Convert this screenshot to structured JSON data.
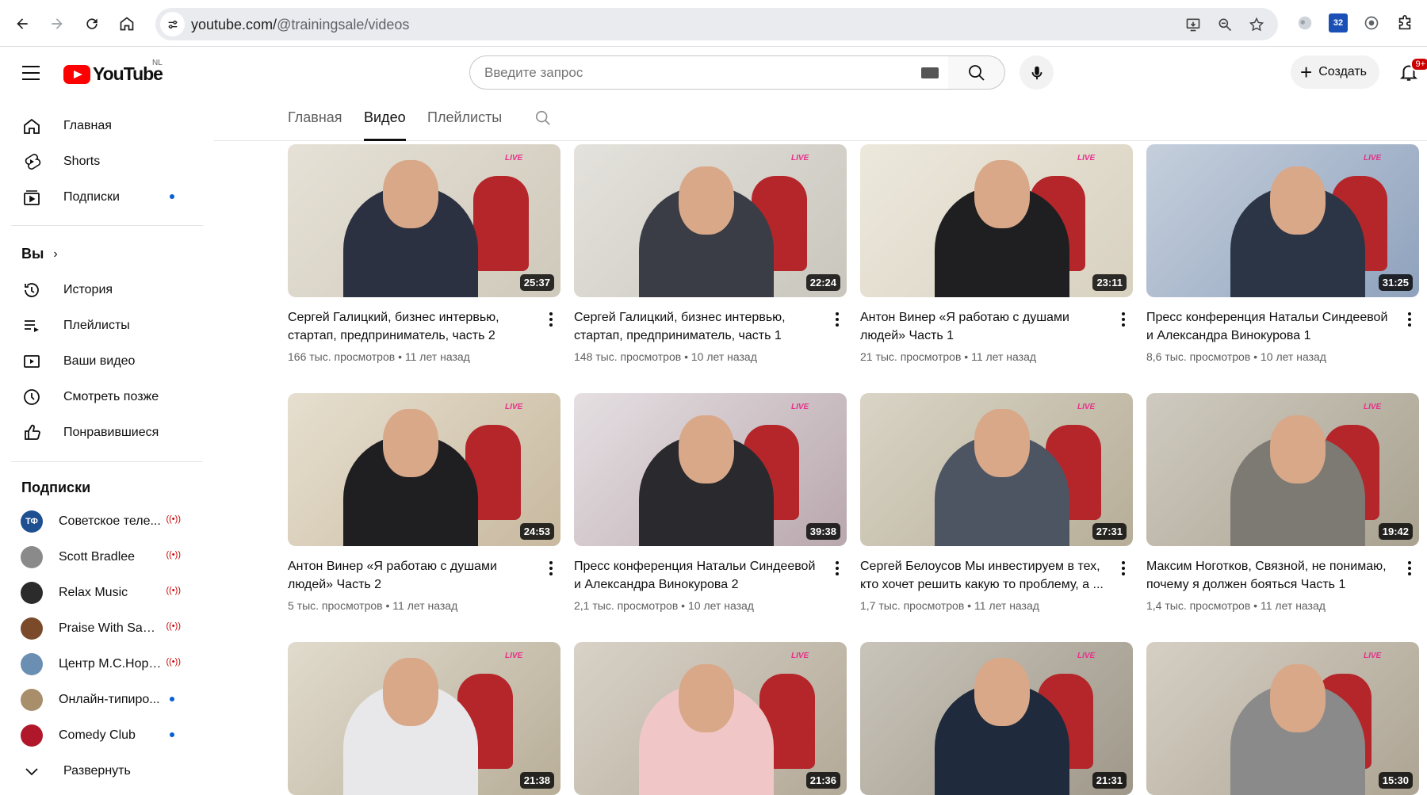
{
  "browser": {
    "url_host": "youtube.com/",
    "url_path": "@trainingsale/videos",
    "ext_badge": "32"
  },
  "masthead": {
    "logo_text": "YouTube",
    "country_code": "NL",
    "search_placeholder": "Введите запрос",
    "create_label": "Создать",
    "notifications_count": "9+"
  },
  "sidebar": {
    "main": [
      {
        "label": "Главная",
        "icon": "home-icon"
      },
      {
        "label": "Shorts",
        "icon": "shorts-icon"
      },
      {
        "label": "Подписки",
        "icon": "subscriptions-icon"
      }
    ],
    "you_heading": "Вы",
    "you": [
      {
        "label": "История",
        "icon": "history-icon"
      },
      {
        "label": "Плейлисты",
        "icon": "playlists-icon"
      },
      {
        "label": "Ваши видео",
        "icon": "your-videos-icon"
      },
      {
        "label": "Смотреть позже",
        "icon": "watch-later-icon"
      },
      {
        "label": "Понравившиеся",
        "icon": "liked-icon"
      }
    ],
    "subs_heading": "Подписки",
    "subscriptions": [
      {
        "label": "Советское теле...",
        "status": "live",
        "color": "#1d4f91"
      },
      {
        "label": "Scott Bradlee",
        "status": "live",
        "color": "#8a8a8a"
      },
      {
        "label": "Relax Music",
        "status": "live",
        "color": "#2b2b2b"
      },
      {
        "label": "Praise With Sang...",
        "status": "live",
        "color": "#7a4a2a"
      },
      {
        "label": "Центр М.С.Норб...",
        "status": "live",
        "color": "#6b8fb3"
      },
      {
        "label": "Онлайн-типиро...",
        "status": "new",
        "color": "#a88e6a"
      },
      {
        "label": "Comedy Club",
        "status": "new",
        "color": "#b0172b"
      }
    ],
    "expand_label": "Развернуть"
  },
  "tabs": [
    {
      "label": "Главная",
      "active": false
    },
    {
      "label": "Видео",
      "active": true
    },
    {
      "label": "Плейлисты",
      "active": false
    }
  ],
  "videos": [
    {
      "title": "Сергей Галицкий, бизнес интервью, стартап, предприниматель, часть 2",
      "views": "166 тыс. просмотров",
      "age": "11 лет назад",
      "duration": "25:37"
    },
    {
      "title": "Сергей Галицкий, бизнес интервью, стартап, предприниматель, часть 1",
      "views": "148 тыс. просмотров",
      "age": "10 лет назад",
      "duration": "22:24"
    },
    {
      "title": "Антон Винер «Я работаю с душами людей» Часть 1",
      "views": "21 тыс. просмотров",
      "age": "11 лет назад",
      "duration": "23:11"
    },
    {
      "title": "Пресс конференция Натальи Синдеевой и Александра Винокурова 1",
      "views": "8,6 тыс. просмотров",
      "age": "10 лет назад",
      "duration": "31:25"
    },
    {
      "title": "Антон Винер «Я работаю с душами людей» Часть 2",
      "views": "5 тыс. просмотров",
      "age": "11 лет назад",
      "duration": "24:53"
    },
    {
      "title": "Пресс конференция Натальи Синдеевой и Александра Винокурова 2",
      "views": "2,1 тыс. просмотров",
      "age": "10 лет назад",
      "duration": "39:38"
    },
    {
      "title": "Сергей Белоусов Мы инвестируем в тех, кто хочет решить какую то проблему, а ...",
      "views": "1,7 тыс. просмотров",
      "age": "11 лет назад",
      "duration": "27:31"
    },
    {
      "title": "Максим Ноготков, Связной, не понимаю, почему я должен бояться Часть 1",
      "views": "1,4 тыс. просмотров",
      "age": "11 лет назад",
      "duration": "19:42"
    },
    {
      "title": "",
      "views": "",
      "age": "",
      "duration": "21:38"
    },
    {
      "title": "",
      "views": "",
      "age": "",
      "duration": "21:36"
    },
    {
      "title": "",
      "views": "",
      "age": "",
      "duration": "21:31"
    },
    {
      "title": "",
      "views": "",
      "age": "",
      "duration": "15:30"
    }
  ],
  "colors": {
    "accent": "#ff0000",
    "live": "#cc0000",
    "new_dot": "#065fd4",
    "chair": "#b5262b"
  }
}
